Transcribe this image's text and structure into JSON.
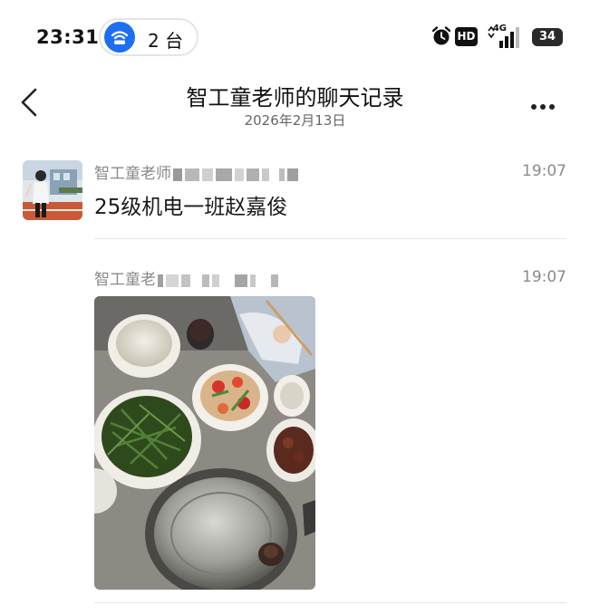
{
  "status_bar": {
    "time": "23:31",
    "devices_label": "2 台",
    "hd": "HD",
    "network": "4G",
    "battery": "34",
    "icons": [
      "wifi-hotspot-icon",
      "alarm-icon",
      "hd-icon",
      "signal-icon",
      "battery-icon"
    ]
  },
  "header": {
    "title": "智工童老师的聊天记录",
    "date": "2026年2月13日",
    "back_icon": "chevron-left-icon",
    "more_icon": "more-dots-icon"
  },
  "messages": [
    {
      "sender": "智工童老师",
      "time": "19:07",
      "type": "text",
      "text": "25级机电一班赵嘉俊"
    },
    {
      "sender": "智工童老",
      "time": "19:07",
      "type": "image"
    }
  ],
  "colors": {
    "accent": "#1e6ff0",
    "divider": "#e6e6e6",
    "meta_text": "#888888"
  }
}
